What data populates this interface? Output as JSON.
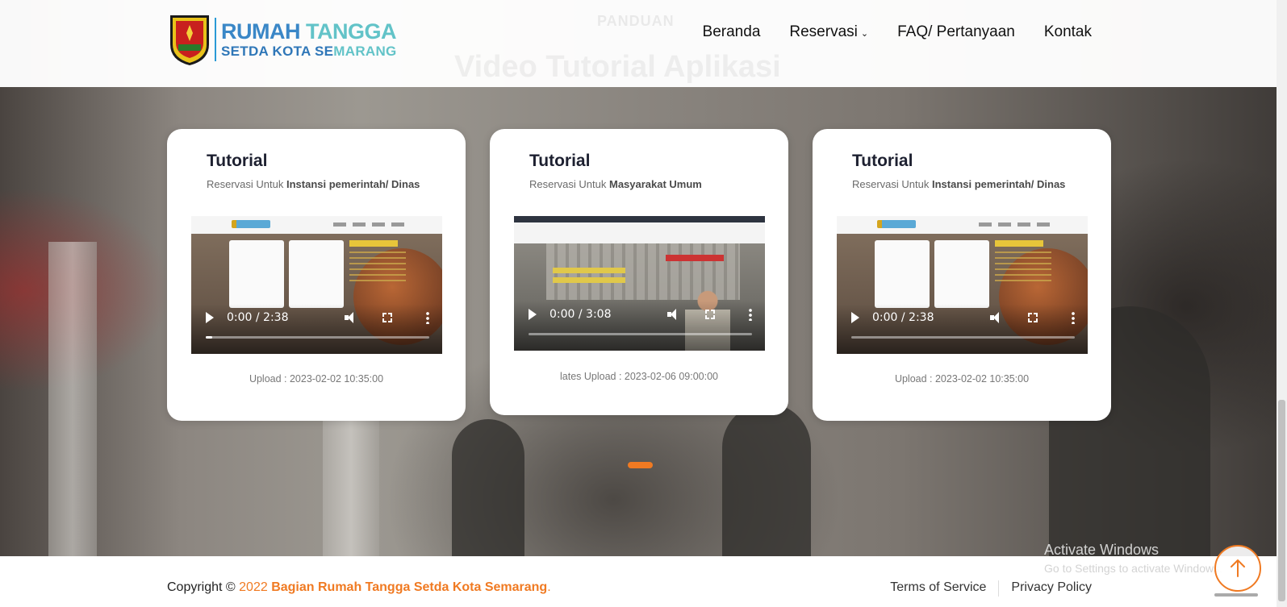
{
  "header": {
    "ghost_subtitle": "PANDUAN",
    "ghost_title": "Video Tutorial Aplikasi",
    "logo": {
      "line1a": "RUMAH",
      "line1b": "TANGGA",
      "line2a": "SETDA KOTA SE",
      "line2b": "MARANG"
    },
    "nav": [
      "Beranda",
      "Reservasi",
      "FAQ/ Pertanyaan",
      "Kontak"
    ]
  },
  "cards": [
    {
      "title": "Tutorial",
      "sub_prefix": "Reservasi Untuk ",
      "sub_bold": "Instansi pemerintah/ Dinas",
      "time": "0:00 / 2:38",
      "progress": 0.03,
      "upload": "Upload : 2023-02-02 10:35:00"
    },
    {
      "title": "Tutorial",
      "sub_prefix": "Reservasi Untuk ",
      "sub_bold": "Masyarakat Umum",
      "time": "0:00 / 3:08",
      "progress": 0,
      "upload": "lates Upload : 2023-02-06 09:00:00"
    },
    {
      "title": "Tutorial",
      "sub_prefix": "Reservasi Untuk ",
      "sub_bold": "Instansi pemerintah/ Dinas",
      "time": "0:00 / 2:38",
      "progress": 0,
      "upload": "Upload : 2023-02-02 10:35:00"
    }
  ],
  "footer": {
    "copyright_prefix": "Copyright © ",
    "year": "2022",
    "org": "Bagian Rumah Tangga Setda Kota Semarang",
    "period": ".",
    "links": [
      "Terms of Service",
      "Privacy Policy"
    ]
  },
  "watermark": {
    "line1": "Activate Windows",
    "line2": "Go to Settings to activate Windows."
  },
  "colors": {
    "accent": "#f07a22",
    "logo_blue": "#3a87c7",
    "logo_teal": "#62c3c8"
  },
  "icons": {
    "scroll_top": "arrow-up-icon",
    "nav_dropdown": "chevron-down-icon"
  }
}
